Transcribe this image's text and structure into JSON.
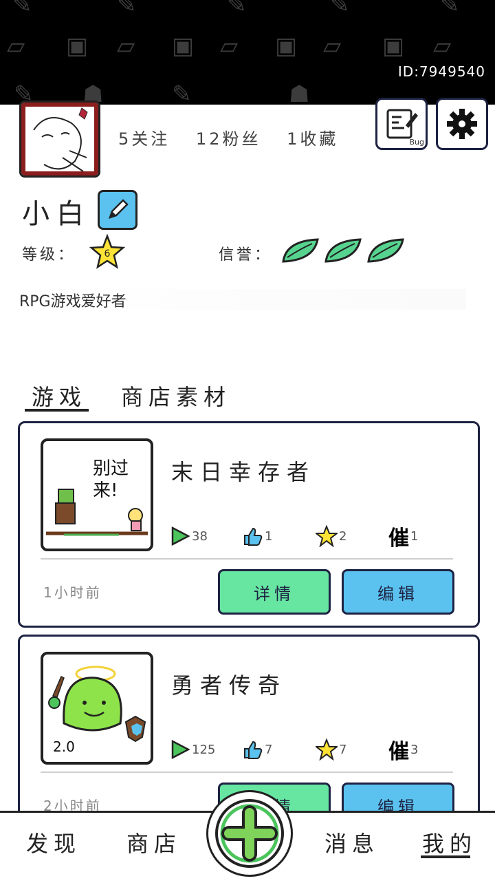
{
  "header": {
    "user_id": "ID:7949540"
  },
  "profile": {
    "follow": "5关注",
    "fans": "12粉丝",
    "favorites": "1收藏",
    "nickname": "小白",
    "level_label": "等级：",
    "level_value": "6",
    "reputation_label": "信誉：",
    "reputation_leaves": 3,
    "bio": "RPG游戏爱好者",
    "bug_label": "Bug"
  },
  "tabs": [
    {
      "label": "游戏",
      "active": true
    },
    {
      "label": "商店素材",
      "active": false
    }
  ],
  "games": [
    {
      "title": "末日幸存者",
      "thumb_text": "别过来!",
      "plays": "38",
      "likes": "1",
      "stars": "2",
      "urges_label": "催",
      "urges": "1",
      "time": "1小时前",
      "detail_label": "详情",
      "edit_label": "编辑"
    },
    {
      "title": "勇者传奇",
      "thumb_text": "2.0",
      "plays": "125",
      "likes": "7",
      "stars": "7",
      "urges_label": "催",
      "urges": "3",
      "time": "2小时前",
      "detail_label": "详情",
      "edit_label": "编辑"
    }
  ],
  "nav": {
    "discover": "发现",
    "shop": "商店",
    "messages": "消息",
    "mine": "我的"
  },
  "colors": {
    "green": "#67e6a2",
    "blue": "#5bc2ef",
    "dark": "#1d2242"
  }
}
